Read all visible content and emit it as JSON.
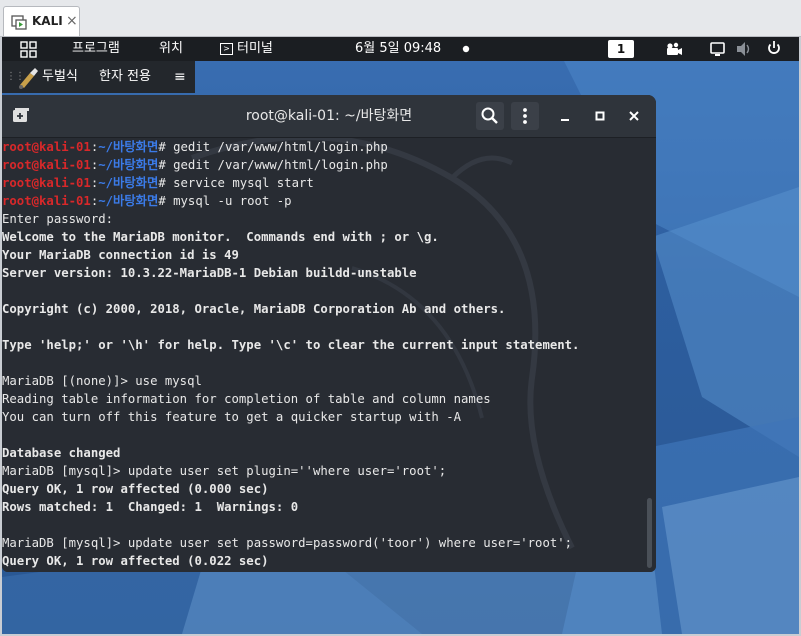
{
  "vm_tab": {
    "label": "KALI",
    "close": "×"
  },
  "top_panel": {
    "programs": "프로그램",
    "location": "위치",
    "terminal": "터미널",
    "clock": "6월 5일  09:48",
    "workspace": "1"
  },
  "ime": {
    "layout": "두벌식",
    "mode": "한자 전용",
    "menu": "≡"
  },
  "terminal": {
    "title": "root@kali-01: ~/바탕화면",
    "lines": [
      {
        "type": "prompt",
        "user": "root@kali-01",
        "sep": ":",
        "path": "~/바탕화면",
        "cmd": "# gedit /var/www/html/login.php"
      },
      {
        "type": "prompt",
        "user": "root@kali-01",
        "sep": ":",
        "path": "~/바탕화면",
        "cmd": "# gedit /var/www/html/login.php"
      },
      {
        "type": "prompt",
        "user": "root@kali-01",
        "sep": ":",
        "path": "~/바탕화면",
        "cmd": "# service mysql start"
      },
      {
        "type": "prompt",
        "user": "root@kali-01",
        "sep": ":",
        "path": "~/바탕화면",
        "cmd": "# mysql -u root -p"
      },
      {
        "type": "text",
        "text": "Enter password:"
      },
      {
        "type": "bold",
        "text": "Welcome to the MariaDB monitor.  Commands end with ; or \\g."
      },
      {
        "type": "bold",
        "text": "Your MariaDB connection id is 49"
      },
      {
        "type": "bold",
        "text": "Server version: 10.3.22-MariaDB-1 Debian buildd-unstable"
      },
      {
        "type": "text",
        "text": ""
      },
      {
        "type": "bold",
        "text": "Copyright (c) 2000, 2018, Oracle, MariaDB Corporation Ab and others."
      },
      {
        "type": "text",
        "text": ""
      },
      {
        "type": "bold",
        "text": "Type 'help;' or '\\h' for help. Type '\\c' to clear the current input statement."
      },
      {
        "type": "text",
        "text": ""
      },
      {
        "type": "text",
        "text": "MariaDB [(none)]> use mysql"
      },
      {
        "type": "text",
        "text": "Reading table information for completion of table and column names"
      },
      {
        "type": "text",
        "text": "You can turn off this feature to get a quicker startup with -A"
      },
      {
        "type": "text",
        "text": ""
      },
      {
        "type": "bold",
        "text": "Database changed"
      },
      {
        "type": "text",
        "text": "MariaDB [mysql]> update user set plugin=''where user='root';"
      },
      {
        "type": "bold",
        "text": "Query OK, 1 row affected (0.000 sec)"
      },
      {
        "type": "bold",
        "text": "Rows matched: 1  Changed: 1  Warnings: 0"
      },
      {
        "type": "text",
        "text": ""
      },
      {
        "type": "text",
        "text": "MariaDB [mysql]> update user set password=password('toor') where user='root';"
      },
      {
        "type": "bold",
        "text": "Query OK, 1 row affected (0.022 sec)"
      }
    ]
  },
  "colors": {
    "prompt_user": "#d8282a",
    "prompt_path": "#3b7be8",
    "terminal_bg": "#282c33",
    "panel_bg": "#1b1e22",
    "desktop": "#2d5e9f"
  }
}
